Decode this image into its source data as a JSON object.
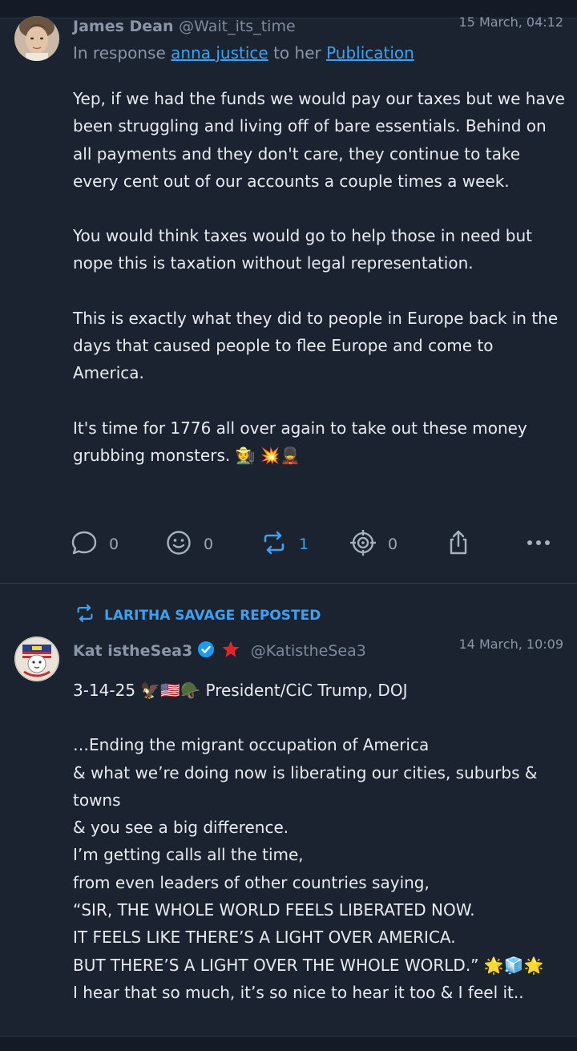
{
  "post1": {
    "author_name": "James Dean",
    "author_handle": "@Wait_its_time",
    "timestamp": "15 March, 04:12",
    "reply_prefix": "In response",
    "reply_user": "anna justice",
    "reply_middle": "to her",
    "reply_target": "Publication",
    "paragraphs": [
      "Yep, if we had the funds we would pay our taxes but we have been struggling and living off of bare essentials. Behind on all payments and they don't care, they continue to take every cent out of our accounts a couple times a week.",
      "You would think taxes would go to help those in need but nope this is taxation without legal representation.",
      "This is exactly what they did to people in Europe back in the days that caused people to flee Europe and come to America.",
      "It's time for 1776 all over again to take out these money grubbing monsters. 🧑‍🌾 💥💂"
    ],
    "actions": {
      "comments": "0",
      "reactions": "0",
      "reposts": "1",
      "target": "0"
    }
  },
  "post2": {
    "repost_label": "LARITHA SAVAGE REPOSTED",
    "author_name": "Kat istheSea3",
    "author_handle": "@KatistheSea3",
    "timestamp": "14 March, 10:09",
    "paragraphs": [
      "3-14-25 🦅🇺🇸🪖 President/CiC Trump, DOJ",
      "…Ending the migrant occupation of America\n& what we’re doing now is liberating our cities, suburbs & towns\n& you see a big difference.\nI’m getting calls all the time,\nfrom even leaders of other countries saying,\n“SIR, THE WHOLE WORLD FEELS LIBERATED NOW.\nIT FEELS LIKE THERE’S A LIGHT OVER AMERICA.\nBUT THERE’S A LIGHT OVER THE WHOLE WORLD.” 🌟🧊🌟\nI hear that so much, it’s so nice to hear it too & I feel it.."
    ]
  },
  "colors": {
    "background": "#1b2330",
    "accent": "#3ea0f0",
    "muted_text": "#8a96a8",
    "verified_badge": "#1d9bf0",
    "star": "#e0262b"
  },
  "icons": {
    "comment": "comment-bubble-icon",
    "reaction": "smiley-icon",
    "repost": "repost-icon",
    "target": "target-icon",
    "share": "share-icon",
    "more": "more-dots-icon",
    "verified": "verified-badge-icon",
    "star": "star-icon"
  }
}
